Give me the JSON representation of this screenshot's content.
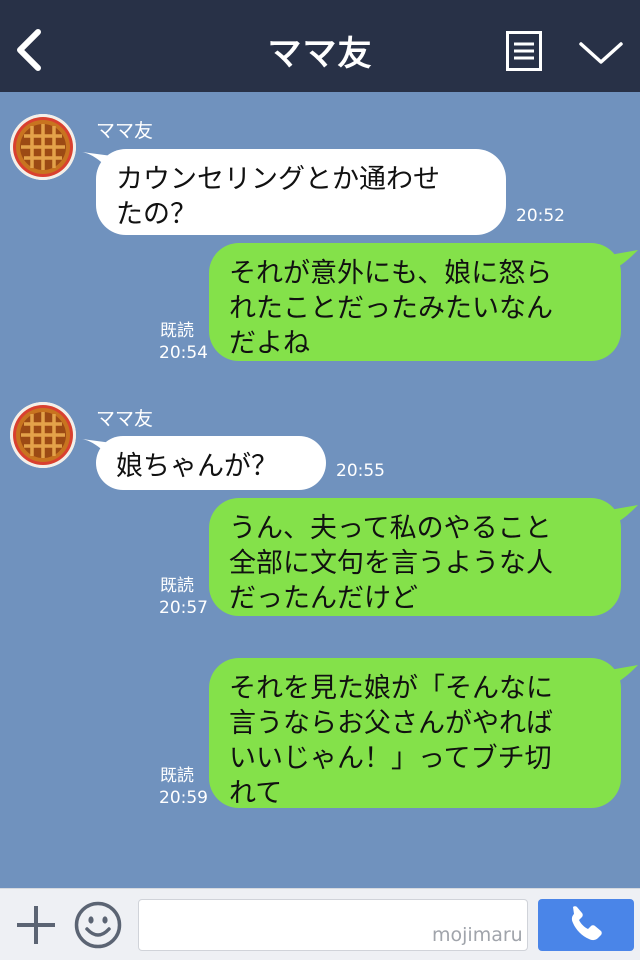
{
  "header": {
    "title": "ママ友"
  },
  "chat": {
    "messages": [
      {
        "side": "left",
        "sender": "ママ友",
        "text": "カウンセリングとか通わせ\nたの？",
        "time": "20:52"
      },
      {
        "side": "right",
        "text": "それが意外にも、娘に怒ら\nれたことだったみたいなん\nだよね",
        "read": "既読",
        "time": "20:54"
      },
      {
        "side": "left",
        "sender": "ママ友",
        "text": "娘ちゃんが？",
        "time": "20:55"
      },
      {
        "side": "right",
        "text": "うん、夫って私のやること\n全部に文句を言うような人\nだったんだけど",
        "read": "既読",
        "time": "20:57"
      },
      {
        "side": "right",
        "text": "それを見た娘が「そんなに\n言うならお父さんがやれば\nいいじゃん！」ってブチ切\nれて",
        "read": "既読",
        "time": "20:59"
      }
    ]
  },
  "footer": {
    "input_value": "",
    "watermark": "mojimaru"
  },
  "colors": {
    "header_bg": "#283147",
    "chat_bg": "#7092be",
    "bubble_left": "#ffffff",
    "bubble_right": "#84e14a",
    "call_button": "#4a85e8"
  },
  "icons": [
    "back-arrow-icon",
    "menu-list-icon",
    "chevron-down-icon",
    "avatar-pie-icon",
    "plus-icon",
    "emoji-icon",
    "phone-icon"
  ]
}
